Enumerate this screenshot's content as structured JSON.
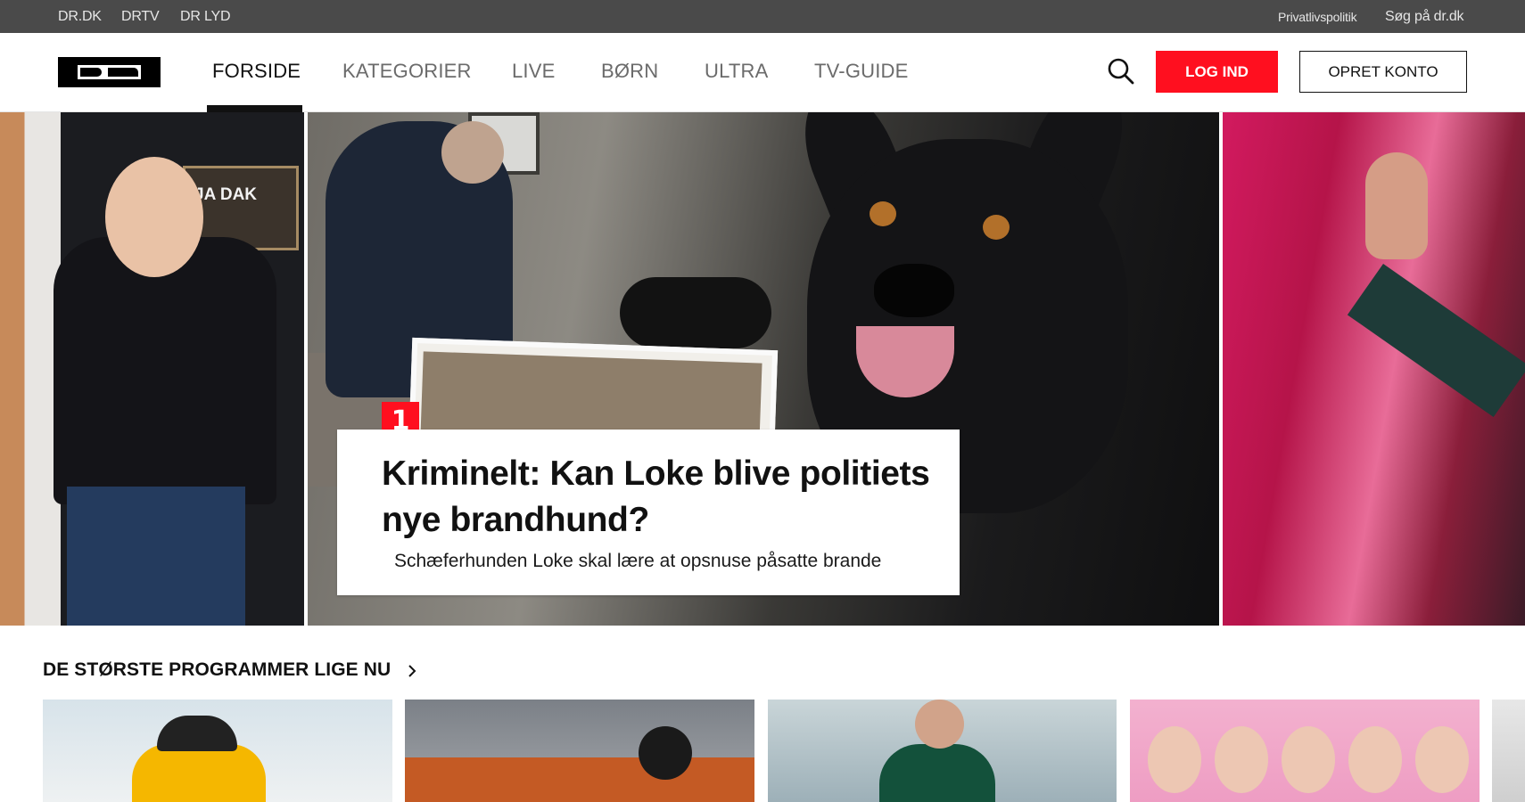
{
  "topbar": {
    "links": [
      "DR.DK",
      "DRTV",
      "DR LYD"
    ],
    "privacy": "Privatlivspolitik",
    "search_site": "Søg på dr.dk"
  },
  "nav": {
    "logo_alt": "DR",
    "items": [
      {
        "label": "FORSIDE",
        "active": true
      },
      {
        "label": "KATEGORIER",
        "active": false
      },
      {
        "label": "LIVE",
        "active": false
      },
      {
        "label": "BØRN",
        "active": false
      },
      {
        "label": "ULTRA",
        "active": false
      },
      {
        "label": "TV-GUIDE",
        "active": false
      }
    ],
    "login_label": "LOG IND",
    "signup_label": "OPRET KONTO",
    "search_icon": "search-icon"
  },
  "hero": {
    "badge": "1",
    "title": "Kriminelt: Kan Loke blive politiets nye brandhund?",
    "subtitle": "Schæferhunden Loke skal lære at opsnuse påsatte brande",
    "left_sign_text": "JA DAK"
  },
  "section": {
    "title": "DE STØRSTE PROGRAMMER LIGE NU",
    "chevron_icon": "chevron-right-icon"
  },
  "colors": {
    "accent": "#ff0f1f",
    "topbar": "#4a4a4a"
  }
}
